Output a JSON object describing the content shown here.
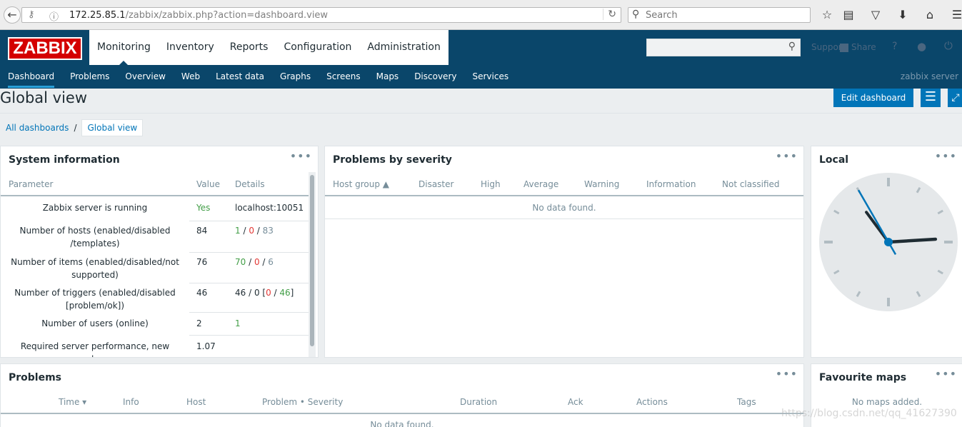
{
  "browser": {
    "url_host": "172.25.85.1",
    "url_path": "/zabbix/zabbix.php?action=dashboard.view",
    "search_placeholder": "Search"
  },
  "header": {
    "logo": "ZABBIX",
    "top_menu": [
      "Monitoring",
      "Inventory",
      "Reports",
      "Configuration",
      "Administration"
    ],
    "support_label": "Support",
    "share_label": "Share",
    "help_label": "?",
    "sub_menu": [
      "Dashboard",
      "Problems",
      "Overview",
      "Web",
      "Latest data",
      "Graphs",
      "Screens",
      "Maps",
      "Discovery",
      "Services"
    ],
    "server_name": "zabbix server"
  },
  "page": {
    "title": "Global view",
    "edit_button": "Edit dashboard",
    "breadcrumb_all": "All dashboards",
    "breadcrumb_sep": "/",
    "breadcrumb_current": "Global view"
  },
  "system_info": {
    "title": "System information",
    "menu": "•••",
    "columns": [
      "Parameter",
      "Value",
      "Details"
    ],
    "rows": [
      {
        "param": "Zabbix server is running",
        "value": "Yes",
        "details": "localhost:10051"
      },
      {
        "param": "Number of hosts (enabled/disabled /templates)",
        "value": "84",
        "d1": "1",
        "d2": "0",
        "d3": "83"
      },
      {
        "param": "Number of items (enabled/disabled/not supported)",
        "value": "76",
        "d1": "70",
        "d2": "0",
        "d3": "6"
      },
      {
        "param": "Number of triggers (enabled/disabled [problem/ok])",
        "value": "46",
        "d0": "46 / 0 [",
        "d1": "0",
        "d2": "46",
        "dend": "]"
      },
      {
        "param": "Number of users (online)",
        "value": "2",
        "details": "1"
      },
      {
        "param": "Required server performance, new values",
        "value": "1.07"
      }
    ]
  },
  "problems_by_severity": {
    "title": "Problems by severity",
    "menu": "•••",
    "columns": [
      "Host group ▲",
      "Disaster",
      "High",
      "Average",
      "Warning",
      "Information",
      "Not classified"
    ],
    "empty": "No data found."
  },
  "local_clock": {
    "title": "Local",
    "menu": "•••",
    "hour": 2,
    "minute": 53,
    "second": 55
  },
  "problems": {
    "title": "Problems",
    "menu": "•••",
    "columns": [
      "Time ▾",
      "Info",
      "Host",
      "Problem • Severity",
      "Duration",
      "Ack",
      "Actions",
      "Tags"
    ],
    "empty": "No data found."
  },
  "favourite_maps": {
    "title": "Favourite maps",
    "menu": "•••",
    "empty": "No maps added."
  },
  "watermark": "https://blog.csdn.net/qq_41627390",
  "colors": {
    "header_bg": "#0a466a",
    "accent": "#0275b8",
    "logo_red": "#d40000",
    "ok_green": "#429e47",
    "problem_red": "#e33734"
  }
}
